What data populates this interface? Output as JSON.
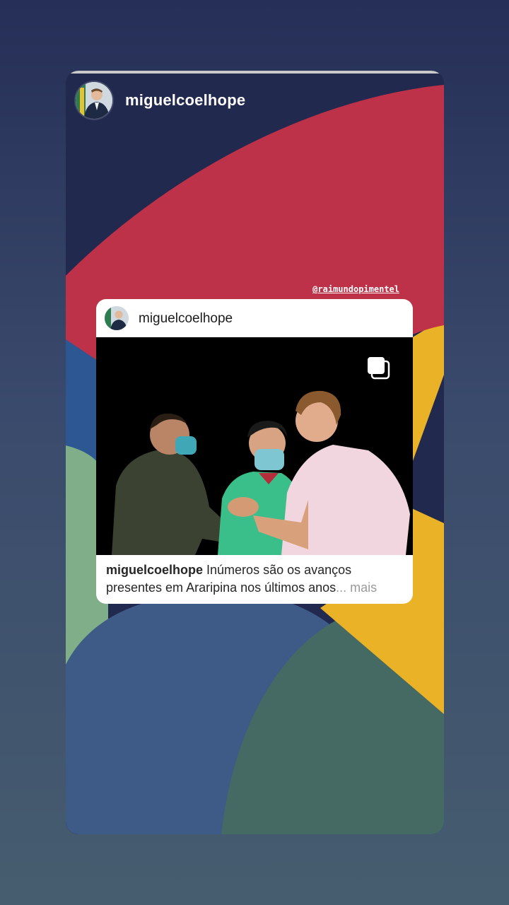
{
  "story": {
    "username": "miguelcoelhope",
    "mention": "@raimundopimentel",
    "colors": {
      "navy": "#22294f",
      "red": "#bd3149",
      "yellow": "#eab226",
      "blue": "#2c5793",
      "green": "#7fae89",
      "slate": "#3e5a86",
      "teal": "#456a64"
    }
  },
  "post": {
    "username": "miguelcoelhope",
    "caption_user": "miguelcoelhope",
    "caption_text": " Inúmeros são os avanços presentes em Araripina nos últimos anos",
    "caption_more": "... mais",
    "carousel_icon": "multiple-photos-icon"
  }
}
